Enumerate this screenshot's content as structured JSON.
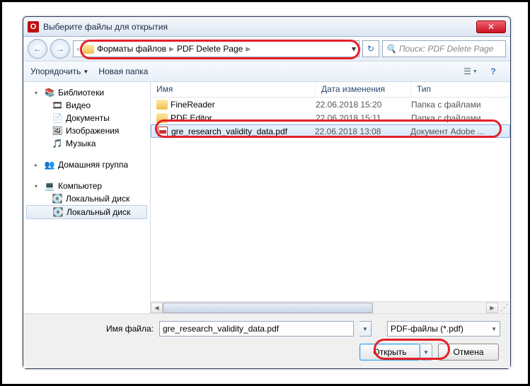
{
  "titlebar": {
    "app_glyph": "O",
    "title": "Выберите файлы для открытия"
  },
  "breadcrumb": {
    "prefix": "«",
    "part1": "Форматы файлов",
    "part2": "PDF Delete Page"
  },
  "search": {
    "placeholder": "Поиск: PDF Delete Page"
  },
  "toolbar": {
    "organize": "Упорядочить",
    "newfolder": "Новая папка"
  },
  "sidebar": {
    "libs": "Библиотеки",
    "video": "Видео",
    "docs": "Документы",
    "images": "Изображения",
    "music": "Музыка",
    "homegroup": "Домашняя группа",
    "computer": "Компьютер",
    "disk1": "Локальный диск",
    "disk2": "Локальный диск"
  },
  "columns": {
    "name": "Имя",
    "date": "Дата изменения",
    "type": "Тип"
  },
  "files": [
    {
      "name": "FineReader",
      "date": "22.06.2018 15:20",
      "type": "Папка с файлами",
      "kind": "folder"
    },
    {
      "name": "PDF Editor",
      "date": "22.06.2018 15:11",
      "type": "Папка с файлами",
      "kind": "folder"
    },
    {
      "name": "gre_research_validity_data.pdf",
      "date": "22.06.2018 13:08",
      "type": "Документ Adobe ...",
      "kind": "pdf"
    }
  ],
  "bottom": {
    "filename_label": "Имя файла:",
    "filename_value": "gre_research_validity_data.pdf",
    "filter": "PDF-файлы (*.pdf)",
    "open": "Открыть",
    "cancel": "Отмена"
  }
}
